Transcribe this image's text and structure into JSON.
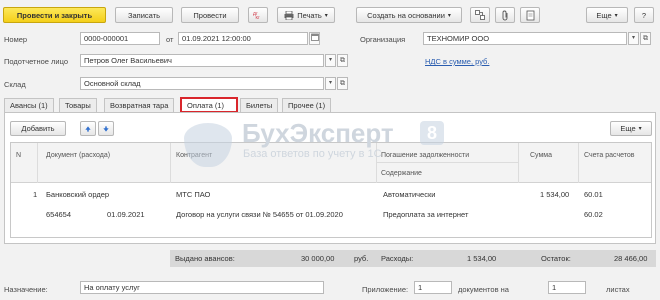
{
  "toolbar": {
    "post_close": "Провести и закрыть",
    "save": "Записать",
    "post": "Провести",
    "print": "Печать",
    "create_based": "Создать на основании",
    "more": "Еще",
    "help": "?"
  },
  "header": {
    "number_label": "Номер",
    "number_value": "0000-000001",
    "date_from_label": "от",
    "date_value": "01.09.2021 12:00:00",
    "org_label": "Организация",
    "org_value": "ТЕХНОМИР ООО",
    "person_label": "Подотчетное лицо",
    "person_value": "Петров Олег Васильевич",
    "vat_link": "НДС в сумме, руб.",
    "warehouse_label": "Склад",
    "warehouse_value": "Основной склад"
  },
  "tabs": [
    {
      "label": "Авансы (1)"
    },
    {
      "label": "Товары"
    },
    {
      "label": "Возвратная тара"
    },
    {
      "label": "Оплата (1)"
    },
    {
      "label": "Билеты"
    },
    {
      "label": "Прочее (1)"
    }
  ],
  "table_toolbar": {
    "add": "Добавить",
    "more": "Еще"
  },
  "table": {
    "headers": {
      "n": "N",
      "doc": "Документ (расхода)",
      "contractor": "Контрагент",
      "repayment": "Погашение задолженности",
      "content": "Содержание",
      "sum": "Сумма",
      "account": "Счета расчетов"
    },
    "rows": [
      {
        "n": "1",
        "doc_type": "Банковский ордер",
        "doc_number": "654654",
        "doc_date": "01.09.2021",
        "contractor": "МТС ПАО",
        "contract": "Договор на услуги связи № 54655 от 01.09.2020",
        "repayment": "Автоматически",
        "content": "Предоплата за интернет",
        "sum": "1 534,00",
        "account1": "60.01",
        "account2": "60.02"
      }
    ]
  },
  "totals": {
    "issued_label": "Выдано авансов:",
    "issued_value": "30 000,00",
    "currency": "руб.",
    "expenses_label": "Расходы:",
    "expenses_value": "1 534,00",
    "balance_label": "Остаток:",
    "balance_value": "28 466,00"
  },
  "footer": {
    "purpose_label": "Назначение:",
    "purpose_value": "На оплату услуг",
    "attachment_label": "Приложение:",
    "attachment_value": "1",
    "docs_on_label": "документов на",
    "sheets_value": "1",
    "sheets_label": "листах"
  },
  "watermark": {
    "brand": "БухЭксперт",
    "digit": "8",
    "subtitle": "База ответов по учету в 1С"
  }
}
